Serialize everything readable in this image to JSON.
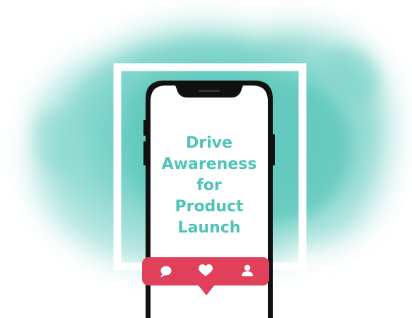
{
  "headline": {
    "lines": [
      "Drive",
      "Awareness",
      "for",
      "Product",
      "Launch"
    ]
  },
  "colors": {
    "watercolor": "#6ccfc6",
    "watercolor_light": "#a9e3dc",
    "headline_text": "#4fc3b8",
    "notification_bar": "#e0405a",
    "phone_body": "#111111",
    "screen": "#ffffff",
    "frame": "#ffffff"
  },
  "icons": {
    "left": "comment-icon",
    "center": "heart-icon",
    "right": "user-icon"
  }
}
